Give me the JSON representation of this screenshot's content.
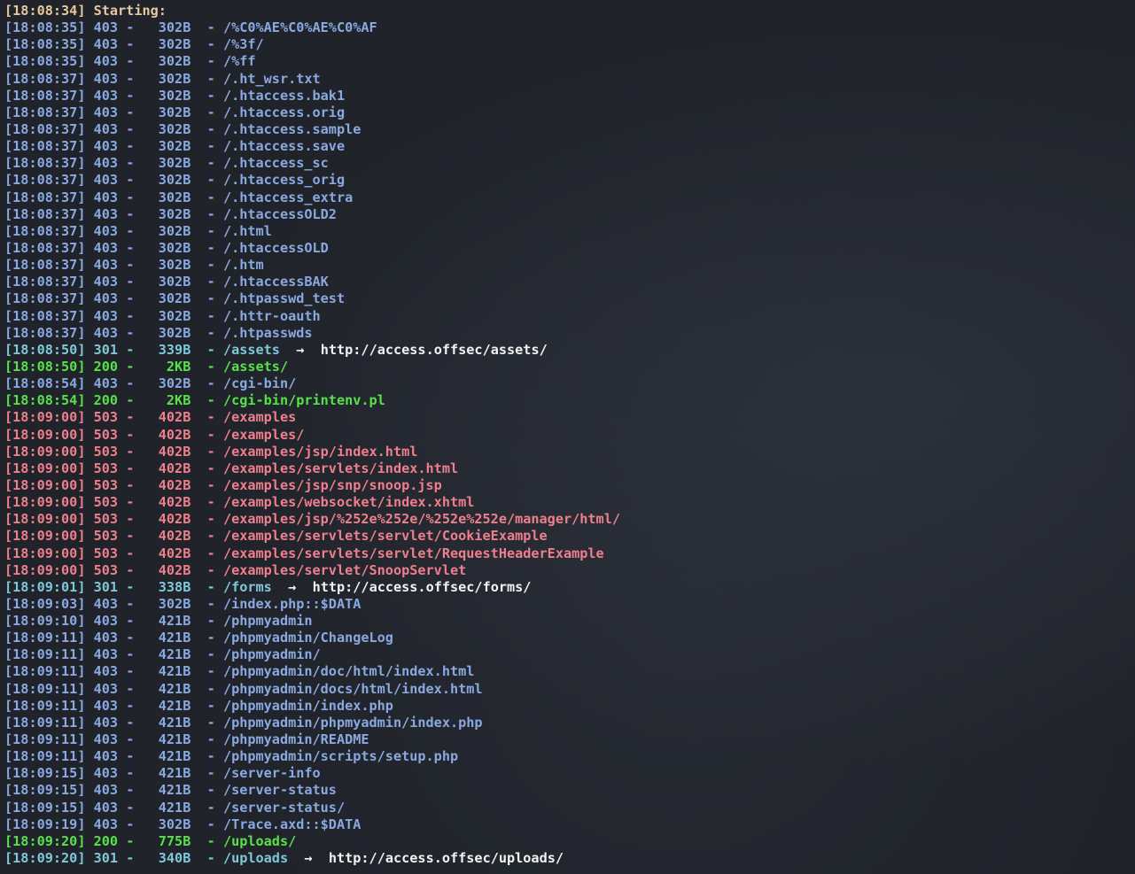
{
  "header": {
    "timestamp": "18:08:34",
    "text": "Starting:"
  },
  "entries": [
    {
      "time": "18:08:35",
      "status": "403",
      "size": "302B",
      "path": "/%C0%AE%C0%AE%C0%AF",
      "redirect": ""
    },
    {
      "time": "18:08:35",
      "status": "403",
      "size": "302B",
      "path": "/%3f/",
      "redirect": ""
    },
    {
      "time": "18:08:35",
      "status": "403",
      "size": "302B",
      "path": "/%ff",
      "redirect": ""
    },
    {
      "time": "18:08:37",
      "status": "403",
      "size": "302B",
      "path": "/.ht_wsr.txt",
      "redirect": ""
    },
    {
      "time": "18:08:37",
      "status": "403",
      "size": "302B",
      "path": "/.htaccess.bak1",
      "redirect": ""
    },
    {
      "time": "18:08:37",
      "status": "403",
      "size": "302B",
      "path": "/.htaccess.orig",
      "redirect": ""
    },
    {
      "time": "18:08:37",
      "status": "403",
      "size": "302B",
      "path": "/.htaccess.sample",
      "redirect": ""
    },
    {
      "time": "18:08:37",
      "status": "403",
      "size": "302B",
      "path": "/.htaccess.save",
      "redirect": ""
    },
    {
      "time": "18:08:37",
      "status": "403",
      "size": "302B",
      "path": "/.htaccess_sc",
      "redirect": ""
    },
    {
      "time": "18:08:37",
      "status": "403",
      "size": "302B",
      "path": "/.htaccess_orig",
      "redirect": ""
    },
    {
      "time": "18:08:37",
      "status": "403",
      "size": "302B",
      "path": "/.htaccess_extra",
      "redirect": ""
    },
    {
      "time": "18:08:37",
      "status": "403",
      "size": "302B",
      "path": "/.htaccessOLD2",
      "redirect": ""
    },
    {
      "time": "18:08:37",
      "status": "403",
      "size": "302B",
      "path": "/.html",
      "redirect": ""
    },
    {
      "time": "18:08:37",
      "status": "403",
      "size": "302B",
      "path": "/.htaccessOLD",
      "redirect": ""
    },
    {
      "time": "18:08:37",
      "status": "403",
      "size": "302B",
      "path": "/.htm",
      "redirect": ""
    },
    {
      "time": "18:08:37",
      "status": "403",
      "size": "302B",
      "path": "/.htaccessBAK",
      "redirect": ""
    },
    {
      "time": "18:08:37",
      "status": "403",
      "size": "302B",
      "path": "/.htpasswd_test",
      "redirect": ""
    },
    {
      "time": "18:08:37",
      "status": "403",
      "size": "302B",
      "path": "/.httr-oauth",
      "redirect": ""
    },
    {
      "time": "18:08:37",
      "status": "403",
      "size": "302B",
      "path": "/.htpasswds",
      "redirect": ""
    },
    {
      "time": "18:08:50",
      "status": "301",
      "size": "339B",
      "path": "/assets",
      "redirect": "http://access.offsec/assets/"
    },
    {
      "time": "18:08:50",
      "status": "200",
      "size": "2KB",
      "path": "/assets/",
      "redirect": ""
    },
    {
      "time": "18:08:54",
      "status": "403",
      "size": "302B",
      "path": "/cgi-bin/",
      "redirect": ""
    },
    {
      "time": "18:08:54",
      "status": "200",
      "size": "2KB",
      "path": "/cgi-bin/printenv.pl",
      "redirect": ""
    },
    {
      "time": "18:09:00",
      "status": "503",
      "size": "402B",
      "path": "/examples",
      "redirect": ""
    },
    {
      "time": "18:09:00",
      "status": "503",
      "size": "402B",
      "path": "/examples/",
      "redirect": ""
    },
    {
      "time": "18:09:00",
      "status": "503",
      "size": "402B",
      "path": "/examples/jsp/index.html",
      "redirect": ""
    },
    {
      "time": "18:09:00",
      "status": "503",
      "size": "402B",
      "path": "/examples/servlets/index.html",
      "redirect": ""
    },
    {
      "time": "18:09:00",
      "status": "503",
      "size": "402B",
      "path": "/examples/jsp/snp/snoop.jsp",
      "redirect": ""
    },
    {
      "time": "18:09:00",
      "status": "503",
      "size": "402B",
      "path": "/examples/websocket/index.xhtml",
      "redirect": ""
    },
    {
      "time": "18:09:00",
      "status": "503",
      "size": "402B",
      "path": "/examples/jsp/%252e%252e/%252e%252e/manager/html/",
      "redirect": ""
    },
    {
      "time": "18:09:00",
      "status": "503",
      "size": "402B",
      "path": "/examples/servlets/servlet/CookieExample",
      "redirect": ""
    },
    {
      "time": "18:09:00",
      "status": "503",
      "size": "402B",
      "path": "/examples/servlets/servlet/RequestHeaderExample",
      "redirect": ""
    },
    {
      "time": "18:09:00",
      "status": "503",
      "size": "402B",
      "path": "/examples/servlet/SnoopServlet",
      "redirect": ""
    },
    {
      "time": "18:09:01",
      "status": "301",
      "size": "338B",
      "path": "/forms",
      "redirect": "http://access.offsec/forms/"
    },
    {
      "time": "18:09:03",
      "status": "403",
      "size": "302B",
      "path": "/index.php::$DATA",
      "redirect": ""
    },
    {
      "time": "18:09:10",
      "status": "403",
      "size": "421B",
      "path": "/phpmyadmin",
      "redirect": ""
    },
    {
      "time": "18:09:11",
      "status": "403",
      "size": "421B",
      "path": "/phpmyadmin/ChangeLog",
      "redirect": ""
    },
    {
      "time": "18:09:11",
      "status": "403",
      "size": "421B",
      "path": "/phpmyadmin/",
      "redirect": ""
    },
    {
      "time": "18:09:11",
      "status": "403",
      "size": "421B",
      "path": "/phpmyadmin/doc/html/index.html",
      "redirect": ""
    },
    {
      "time": "18:09:11",
      "status": "403",
      "size": "421B",
      "path": "/phpmyadmin/docs/html/index.html",
      "redirect": ""
    },
    {
      "time": "18:09:11",
      "status": "403",
      "size": "421B",
      "path": "/phpmyadmin/index.php",
      "redirect": ""
    },
    {
      "time": "18:09:11",
      "status": "403",
      "size": "421B",
      "path": "/phpmyadmin/phpmyadmin/index.php",
      "redirect": ""
    },
    {
      "time": "18:09:11",
      "status": "403",
      "size": "421B",
      "path": "/phpmyadmin/README",
      "redirect": ""
    },
    {
      "time": "18:09:11",
      "status": "403",
      "size": "421B",
      "path": "/phpmyadmin/scripts/setup.php",
      "redirect": ""
    },
    {
      "time": "18:09:15",
      "status": "403",
      "size": "421B",
      "path": "/server-info",
      "redirect": ""
    },
    {
      "time": "18:09:15",
      "status": "403",
      "size": "421B",
      "path": "/server-status",
      "redirect": ""
    },
    {
      "time": "18:09:15",
      "status": "403",
      "size": "421B",
      "path": "/server-status/",
      "redirect": ""
    },
    {
      "time": "18:09:19",
      "status": "403",
      "size": "302B",
      "path": "/Trace.axd::$DATA",
      "redirect": ""
    },
    {
      "time": "18:09:20",
      "status": "200",
      "size": "775B",
      "path": "/uploads/",
      "redirect": ""
    },
    {
      "time": "18:09:20",
      "status": "301",
      "size": "340B",
      "path": "/uploads",
      "redirect": "http://access.offsec/uploads/"
    }
  ],
  "colors": {
    "background": "#20232a",
    "starting": "#e7c9a0",
    "status_403": "#89a9e0",
    "status_301": "#7fc8d8",
    "status_200": "#57e14a",
    "status_503": "#ee7f8c",
    "redirect": "#f2f2f2"
  }
}
